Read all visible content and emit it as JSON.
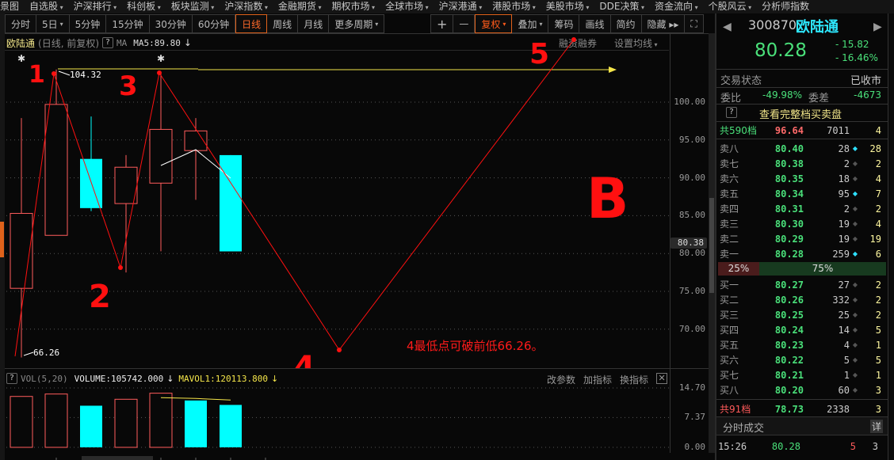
{
  "menubar": {
    "items": [
      {
        "label": "景图",
        "dd": false
      },
      {
        "label": "自选股",
        "dd": true
      },
      {
        "label": "沪深排行",
        "dd": true
      },
      {
        "label": "科创板",
        "dd": true
      },
      {
        "label": "板块监测",
        "dd": true
      },
      {
        "label": "沪深指数",
        "dd": true
      },
      {
        "label": "金融期货",
        "dd": true
      },
      {
        "label": "期权市场",
        "dd": true
      },
      {
        "label": "全球市场",
        "dd": true
      },
      {
        "label": "沪深港通",
        "dd": true
      },
      {
        "label": "港股市场",
        "dd": true
      },
      {
        "label": "美股市场",
        "dd": true
      },
      {
        "label": "DDE决策",
        "dd": true
      },
      {
        "label": "资金流向",
        "dd": true
      },
      {
        "label": "个股风云",
        "dd": true
      },
      {
        "label": "分析师指数",
        "dd": false
      }
    ]
  },
  "toolbar": {
    "periods": [
      {
        "label": "分时",
        "dd": false,
        "active": false
      },
      {
        "label": "5日",
        "dd": true,
        "active": false
      },
      {
        "label": "5分钟",
        "dd": false,
        "active": false
      },
      {
        "label": "15分钟",
        "dd": false,
        "active": false
      },
      {
        "label": "30分钟",
        "dd": false,
        "active": false
      },
      {
        "label": "60分钟",
        "dd": false,
        "active": false
      },
      {
        "label": "日线",
        "dd": false,
        "active": true
      },
      {
        "label": "周线",
        "dd": false,
        "active": false
      },
      {
        "label": "月线",
        "dd": false,
        "active": false
      },
      {
        "label": "更多周期",
        "dd": true,
        "active": false
      }
    ],
    "zoom_in": "+",
    "zoom_out": "—",
    "fuquan": "复权",
    "overlay": "叠加",
    "chips": "筹码",
    "draw": "画线",
    "simple": "简约",
    "hide": "隐藏 ▸▸",
    "fullscreen": "⛶"
  },
  "chart_header": {
    "name": "欧陆通",
    "mode": "(日线, 前复权)",
    "help": "?",
    "ma_label": "MA",
    "ma5": "MA5:89.80",
    "arrow": "↓",
    "margin": "融资融券",
    "set_ma": "设置均线"
  },
  "price_axis": {
    "ticks": [
      "100.00",
      "95.00",
      "90.00",
      "85.00",
      "80.00",
      "75.00",
      "70.00"
    ],
    "current": "80.38"
  },
  "annotations": {
    "high_label": "104.32",
    "low_label": "66.26",
    "note": "4最低点可破前低66.26。",
    "marks": [
      "1",
      "2",
      "3",
      "4",
      "5",
      "B"
    ]
  },
  "chart_data": {
    "type": "candlestick",
    "title": "欧陆通 (日线, 前复权)",
    "ylim": [
      63,
      108
    ],
    "candles": [
      {
        "open": 75.4,
        "close": 85.3,
        "high": 97.9,
        "low": 66.26,
        "dir": "up"
      },
      {
        "open": 82.4,
        "close": 99.7,
        "high": 104.32,
        "low": 82.4,
        "dir": "up"
      },
      {
        "open": 92.5,
        "close": 86.0,
        "high": 98.1,
        "low": 85.6,
        "dir": "down"
      },
      {
        "open": 86.6,
        "close": 91.4,
        "high": 93.0,
        "low": 77.5,
        "dir": "up"
      },
      {
        "open": 89.3,
        "close": 96.4,
        "high": 103.9,
        "low": 80.3,
        "dir": "up"
      },
      {
        "open": 93.6,
        "close": 96.2,
        "high": 97.9,
        "low": 87.1,
        "dir": "up"
      },
      {
        "open": 93.0,
        "close": 80.28,
        "high": 93.0,
        "low": 80.28,
        "dir": "down"
      }
    ],
    "ma5": [
      null,
      null,
      null,
      null,
      90.8,
      92.3,
      89.8
    ],
    "volume": {
      "label": "VOL(5,20)",
      "volume_text": "VOLUME:105742.000",
      "mavol_text": "MAVOL1:120113.800",
      "values": [
        12.6,
        13.2,
        10.3,
        11.9,
        13.4,
        11.6,
        10.5
      ],
      "dirs": [
        "up",
        "up",
        "down",
        "up",
        "up",
        "down",
        "down"
      ],
      "mavol": [
        null,
        null,
        null,
        null,
        12.3,
        12.1,
        11.7
      ],
      "ticks": [
        "14.70",
        "7.37",
        "0.00"
      ],
      "buttons": [
        "改参数",
        "加指标",
        "换指标"
      ]
    }
  },
  "quote": {
    "code": "300870",
    "name": "欧陆通",
    "price": "80.28",
    "change": "- 15.82",
    "change_pct": "- 16.46%",
    "status_label": "交易状态",
    "status_value": "已收市",
    "weibi_label": "委比",
    "weibi_value": "-49.98%",
    "weicha_label": "委差",
    "weicha_value": "-4673",
    "full_book": "查看完整档买卖盘",
    "ask_total": {
      "label": "共590档",
      "price": "96.64",
      "vol": "7011",
      "cnt": "4"
    },
    "asks": [
      {
        "label": "卖八",
        "price": "80.40",
        "vol": "28",
        "cyan": true,
        "cnt": "28"
      },
      {
        "label": "卖七",
        "price": "80.38",
        "vol": "2",
        "cyan": false,
        "cnt": "2"
      },
      {
        "label": "卖六",
        "price": "80.35",
        "vol": "18",
        "cyan": false,
        "cnt": "4"
      },
      {
        "label": "卖五",
        "price": "80.34",
        "vol": "95",
        "cyan": true,
        "cnt": "7"
      },
      {
        "label": "卖四",
        "price": "80.31",
        "vol": "2",
        "cyan": false,
        "cnt": "2"
      },
      {
        "label": "卖三",
        "price": "80.30",
        "vol": "19",
        "cyan": false,
        "cnt": "4"
      },
      {
        "label": "卖二",
        "price": "80.29",
        "vol": "19",
        "cyan": false,
        "cnt": "19"
      },
      {
        "label": "卖一",
        "price": "80.28",
        "vol": "259",
        "cyan": true,
        "cnt": "6"
      }
    ],
    "ratio_sell": "25%",
    "ratio_buy": "75%",
    "bids": [
      {
        "label": "买一",
        "price": "80.27",
        "vol": "27",
        "cyan": false,
        "cnt": "2"
      },
      {
        "label": "买二",
        "price": "80.26",
        "vol": "332",
        "cyan": false,
        "cnt": "2"
      },
      {
        "label": "买三",
        "price": "80.25",
        "vol": "25",
        "cyan": false,
        "cnt": "2"
      },
      {
        "label": "买四",
        "price": "80.24",
        "vol": "14",
        "cyan": false,
        "cnt": "5"
      },
      {
        "label": "买五",
        "price": "80.23",
        "vol": "4",
        "cyan": false,
        "cnt": "1"
      },
      {
        "label": "买六",
        "price": "80.22",
        "vol": "5",
        "cyan": false,
        "cnt": "5"
      },
      {
        "label": "买七",
        "price": "80.21",
        "vol": "1",
        "cyan": false,
        "cnt": "1"
      },
      {
        "label": "买八",
        "price": "80.20",
        "vol": "60",
        "cyan": false,
        "cnt": "3"
      }
    ],
    "bid_total": {
      "label": "共91档",
      "price": "78.73",
      "vol": "2338",
      "cnt": "3"
    },
    "ticks_title": "分时成交",
    "ticks_detail": "详",
    "trade": {
      "time": "15:26",
      "price": "80.28",
      "vol": "5",
      "cnt": "3"
    }
  }
}
